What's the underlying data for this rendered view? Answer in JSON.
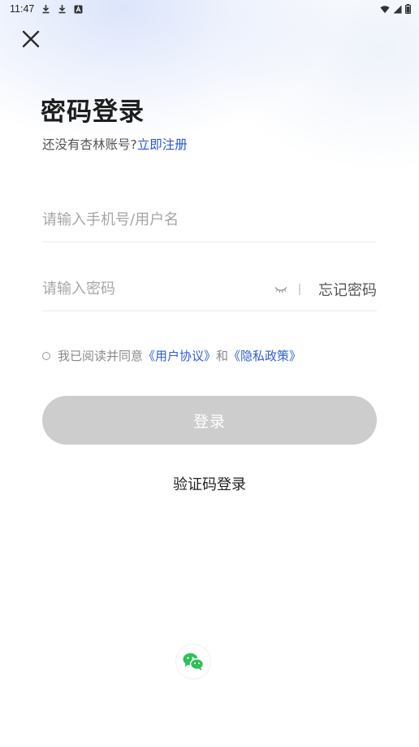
{
  "status_bar": {
    "time": "11:47",
    "icons": [
      "download-icon",
      "download-icon",
      "notification-a-icon",
      "wifi-icon",
      "cellular-signal-icon",
      "battery-icon"
    ]
  },
  "header": {
    "close_icon": "close-icon",
    "title": "密码登录",
    "subtitle_text": "还没有杏林账号?",
    "register_link": "立即注册"
  },
  "form": {
    "username_placeholder": "请输入手机号/用户名",
    "username_value": "",
    "password_placeholder": "请输入密码",
    "password_value": "",
    "eye_icon": "eye-closed-icon",
    "forgot_password": "忘记密码"
  },
  "agreement": {
    "prefix": "我已阅读并同意",
    "user_agreement": "《用户协议》",
    "conjunction": "和",
    "privacy_policy": "《隐私政策》",
    "checked": false
  },
  "actions": {
    "login_label": "登录",
    "code_login_label": "验证码登录",
    "wechat_icon": "wechat-icon"
  },
  "colors": {
    "link": "#2457d6",
    "login_button_disabled": "#cdcdcd",
    "wechat_green": "#2dc157"
  }
}
